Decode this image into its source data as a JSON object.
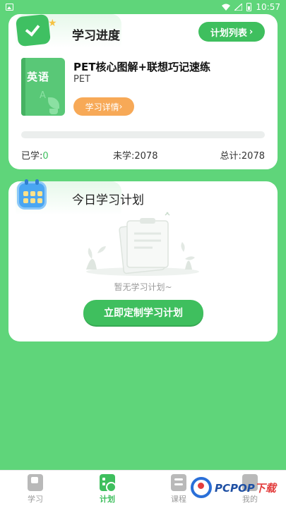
{
  "status_bar": {
    "time": "10:57"
  },
  "progress_card": {
    "title": "学习进度",
    "plan_list_button": "计划列表",
    "book": {
      "cover_label": "英语",
      "cover_letter": "A",
      "title": "PET核心图解+联想巧记速练",
      "subtitle": "PET"
    },
    "detail_button": "学习详情",
    "progress_fraction": 0,
    "stats": {
      "learned_label": "已学:",
      "learned_value": "0",
      "unlearned_label": "未学:",
      "unlearned_value": "2078",
      "total_label": "总计:",
      "total_value": "2078"
    }
  },
  "today_card": {
    "title": "今日学习计划",
    "empty_text": "暂无学习计划~",
    "custom_button": "立即定制学习计划"
  },
  "bottom_nav": {
    "items": [
      {
        "label": "学习",
        "icon": "book-icon"
      },
      {
        "label": "计划",
        "icon": "plan-icon"
      },
      {
        "label": "课程",
        "icon": "course-icon"
      },
      {
        "label": "我的",
        "icon": "profile-icon"
      }
    ],
    "active_index": 1
  },
  "watermark": {
    "text_main": "PCPOP",
    "text_suffix": "下载"
  },
  "colors": {
    "background": "#5fd57a",
    "accent_green": "#3fbf5e",
    "detail_orange": "#f7a957",
    "calendar_blue": "#4aa6f2"
  }
}
